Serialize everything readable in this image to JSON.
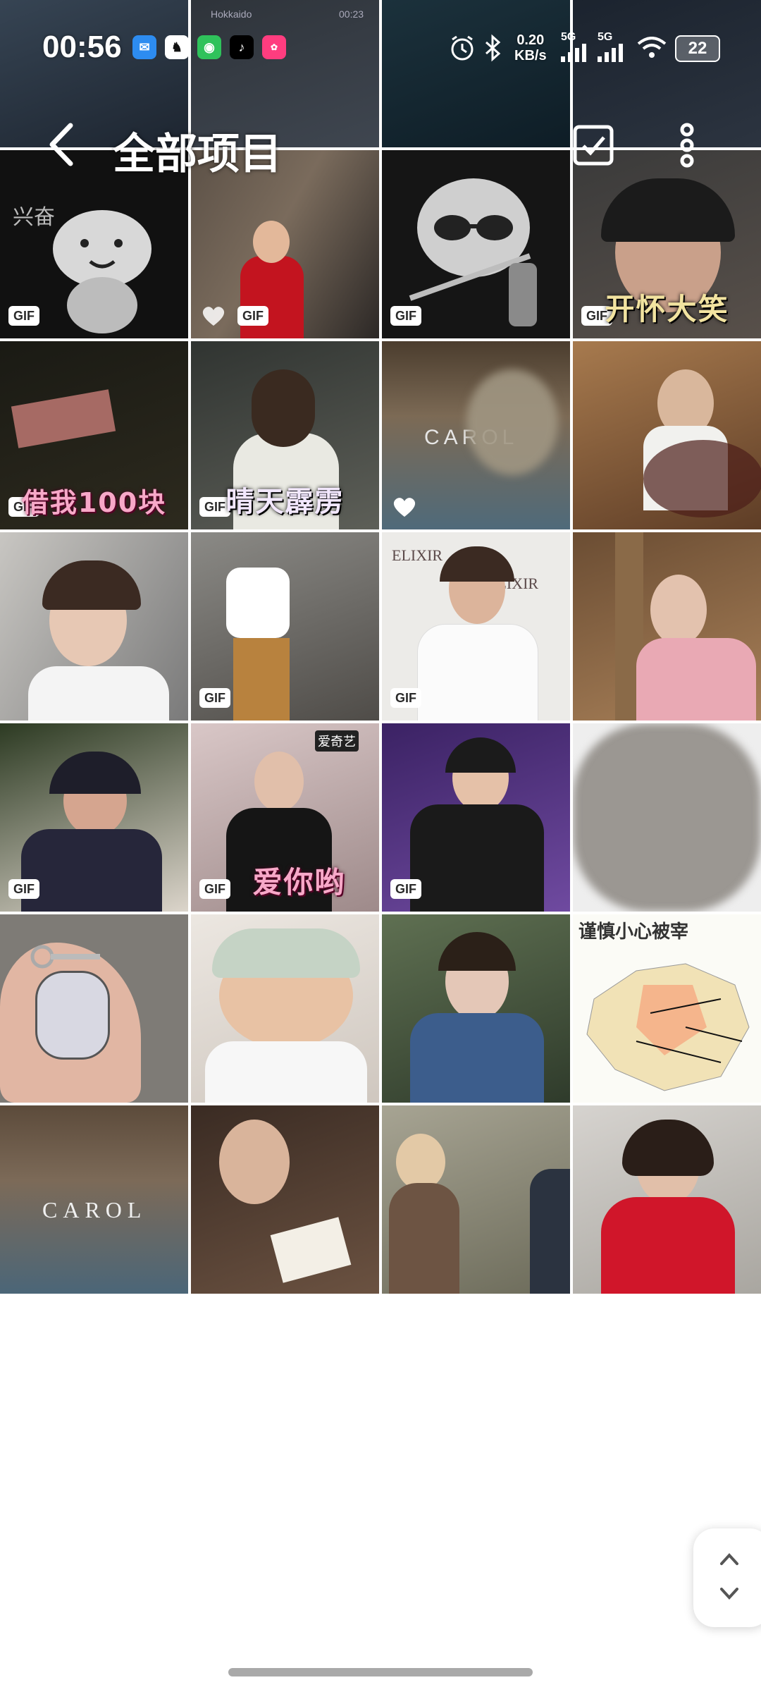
{
  "status_bar": {
    "time": "00:56",
    "network_speed_value": "0.20",
    "network_speed_unit": "KB/s",
    "signal1_label": "5G",
    "signal2_label": "5G",
    "battery": "22",
    "app_icons": [
      "mail-icon",
      "qq-icon",
      "wechat-icon",
      "tiktok-icon",
      "pink-app-icon"
    ]
  },
  "header": {
    "title": "全部项目"
  },
  "watermark": "兴奋",
  "badges": {
    "gif": "GIF"
  },
  "top_row_text": {
    "location": "Hokkaido",
    "time": "00:23"
  },
  "captions": {
    "laugh": "开怀大笑",
    "borrow": "借我100块",
    "thunder": "晴天霹雳",
    "love": "爱你哟",
    "iqiyi": "爱奇艺",
    "elixir": "ELIXIR",
    "carol": "CAROL",
    "map_title": "谨慎小心被宰"
  },
  "colors": {
    "accent_red": "#d0162a",
    "white": "#ffffff"
  }
}
